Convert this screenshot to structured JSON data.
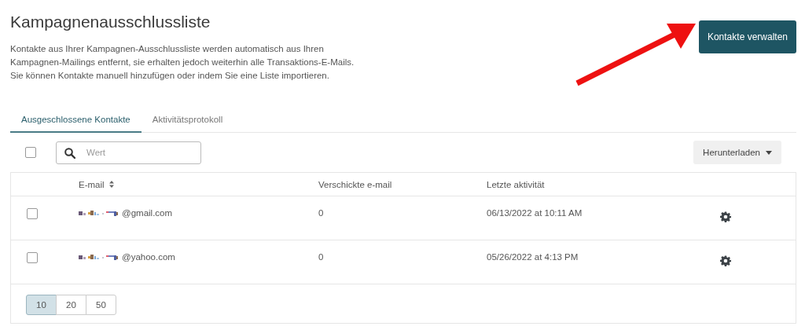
{
  "header": {
    "title": "Kampagnenausschlussliste",
    "description": [
      "Kontakte aus Ihrer Kampagnen-Ausschlussliste werden automatisch aus Ihren",
      "Kampagnen-Mailings entfernt, sie erhalten jedoch weiterhin alle Transaktions-E-Mails.",
      "Sie können Kontakte manuell hinzufügen oder indem Sie eine Liste importieren."
    ],
    "action_button": "Kontakte verwalten"
  },
  "annotation": {
    "kind": "arrow",
    "color": "#ee1111"
  },
  "tabs": [
    {
      "label": "Ausgeschlossene Kontakte",
      "selected": true
    },
    {
      "label": "Aktivitätsprotokoll",
      "selected": false
    }
  ],
  "toolbar": {
    "select_all_checked": false,
    "search": {
      "placeholder": "Wert"
    },
    "download_button": "Herunterladen"
  },
  "table": {
    "columns": [
      {
        "label": "E-mail",
        "sortable": true
      },
      {
        "label": "Verschickte e-mail",
        "sortable": false
      },
      {
        "label": "Letzte aktivität",
        "sortable": false
      }
    ],
    "rows": [
      {
        "checked": false,
        "email_domain": "@gmail.com",
        "redacted": true,
        "sent": "0",
        "last_activity": "06/13/2022 at 10:11 AM"
      },
      {
        "checked": false,
        "email_domain": "@yahoo.com",
        "redacted": true,
        "sent": "0",
        "last_activity": "05/26/2022 at 4:13 PM"
      }
    ]
  },
  "page_sizes": [
    {
      "label": "10",
      "selected": true
    },
    {
      "label": "20",
      "selected": false
    },
    {
      "label": "50",
      "selected": false
    }
  ]
}
